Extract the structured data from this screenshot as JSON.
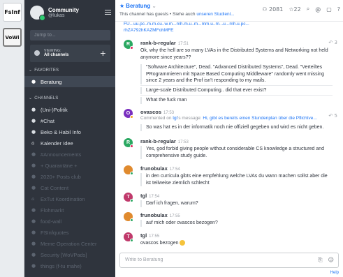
{
  "rail": {
    "servers": [
      {
        "label": "FsInf",
        "icon": "fsinf-logo"
      },
      {
        "label": "VoWi",
        "icon": "vowi-logo"
      }
    ]
  },
  "sidebar": {
    "workspace": "Community",
    "user": "@lukas",
    "jump_placeholder": "Jump to...",
    "viewing_label": "VIEWING:",
    "viewing_value": "All channels",
    "favorites_label": "FAVORITES",
    "favorites": [
      {
        "name": "Beratung",
        "icon": "hash-icon"
      }
    ],
    "channels_label": "CHANNELS",
    "channels": [
      {
        "name": "(Uni-)Politik",
        "icon": "globe-icon",
        "muted": false
      },
      {
        "name": "#Chat",
        "icon": "globe-icon",
        "muted": false
      },
      {
        "name": "Beko & Habil Info",
        "icon": "globe-icon",
        "muted": false
      },
      {
        "name": "Kalender Idee",
        "icon": "lock-icon",
        "muted": false
      },
      {
        "name": "#Announcements",
        "icon": "globe-icon",
        "muted": true
      },
      {
        "name": "+ Quarantäne +",
        "icon": "globe-icon",
        "muted": true
      },
      {
        "name": "2020+ Posts club",
        "icon": "globe-icon",
        "muted": true
      },
      {
        "name": "Cat Content",
        "icon": "globe-icon",
        "muted": true
      },
      {
        "name": "ExTut Koordination",
        "icon": "lock-icon",
        "muted": true
      },
      {
        "name": "Flohmarkt",
        "icon": "globe-icon",
        "muted": true
      },
      {
        "name": "food-wall",
        "icon": "globe-icon",
        "muted": true
      },
      {
        "name": "FSInfquotes",
        "icon": "globe-icon",
        "muted": true
      },
      {
        "name": "Meme Operation Center",
        "icon": "globe-icon",
        "muted": true
      },
      {
        "name": "Security [WoVPads]",
        "icon": "globe-icon",
        "muted": true
      },
      {
        "name": "things (f-tu mahe)",
        "icon": "globe-icon",
        "muted": true
      }
    ]
  },
  "header": {
    "title": "Beratung",
    "description_prefix": "This channel has guests • Siehe auch ",
    "description_link": "unseren Studienl...",
    "members": "2081",
    "pinned": "22"
  },
  "messages": {
    "top_fragment_1": "FU...uu.pc..m.m.cu..w.m...mh.m.u..m...mm.u..m...u...mh.u.pc...",
    "top_fragment_2": "rhZA792hKAZMFohMFE",
    "items": [
      {
        "user": "rank-b-regular",
        "time": "17:51",
        "avatar_letter": "R",
        "avatar_color": "#2aa861",
        "reply_count": "3",
        "lines": [
          "Ok, why the hell are so many LVAs in the Distributed Systems and Networking not held",
          "anymore since years??"
        ],
        "quotes": [
          "\"Software Architecture\", Dead. \"Advanced Distributed Systems\", Dead. \"Verteiltes",
          "PRogrammieren mit Space Based Computing Middleware\" randomly went missing",
          "since 2 years and the Prof isn't responding to my mails.",
          "Large-scale Distributed Computing.. did that ever exist?",
          "What the fuck man"
        ]
      },
      {
        "user": "ovascos",
        "time": "17:53",
        "avatar_letter": "O",
        "avatar_color": "#7a2fbf",
        "reply_count": "5",
        "ctx_prefix": "Commented on ",
        "ctx_user": "tgl",
        "ctx_mid": "'s message: ",
        "ctx_link": "Hi, gibt es bereits einen Stundenplan über die Pflichtve...",
        "quote": "So was hat es in der informatik noch nie offiziell gegeben und wird es nicht geben."
      },
      {
        "user": "rank-b-regular",
        "time": "17:53",
        "avatar_letter": "R",
        "avatar_color": "#2aa861",
        "quotes": [
          "Yes, god forbid giving people without considerable CS knowledge a structured and",
          "comprehensive study guide."
        ]
      },
      {
        "user": "frunobulax",
        "time": "17:54",
        "quotes": [
          "in den curricula gibts eine empfehlung welche LVAs du wann machen sollst aber die",
          "ist teilweise ziemlich schlecht"
        ]
      },
      {
        "user": "tgl",
        "time": "17:54",
        "avatar_letter": "T",
        "avatar_color": "#c0396b",
        "quotes": [
          "Darf ich fragen, warum?"
        ]
      },
      {
        "user": "frunobulax",
        "time": "17:55",
        "quotes": [
          "auf mich oder ovascos bezogen?"
        ]
      },
      {
        "user": "tgl",
        "time": "17:55",
        "avatar_letter": "T",
        "avatar_color": "#c0396b",
        "text": "ovascos bezogen"
      }
    ]
  },
  "composer": {
    "placeholder": "Write to Beratung",
    "help": "Help"
  }
}
